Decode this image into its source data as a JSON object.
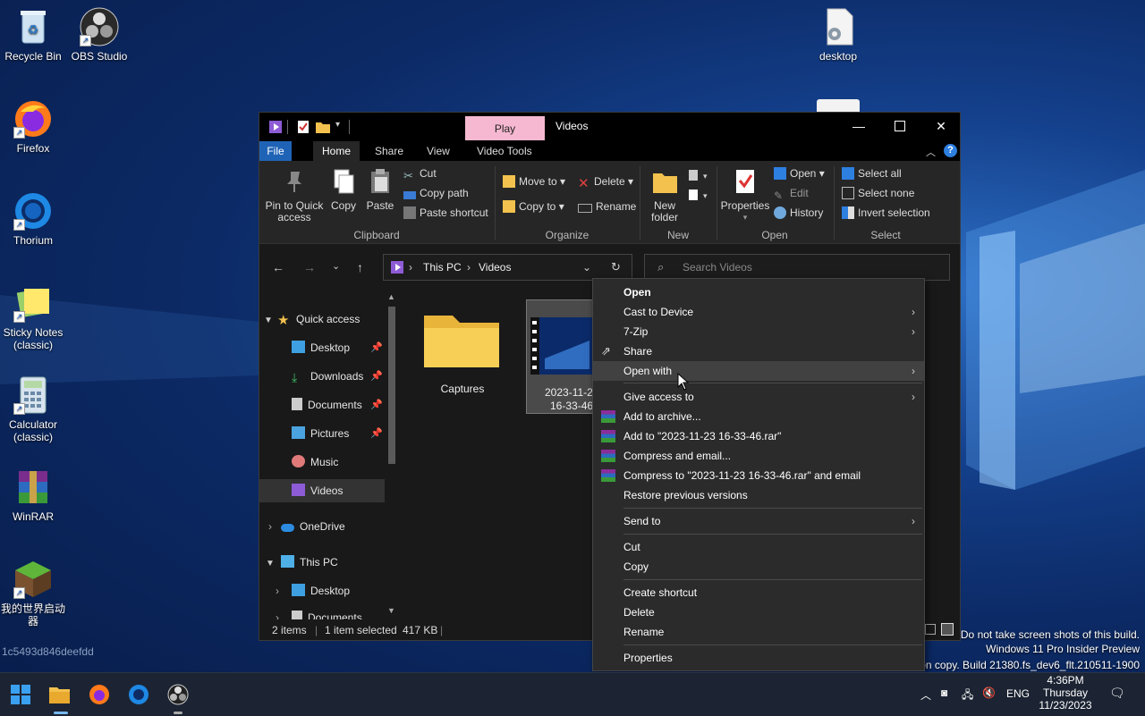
{
  "desktop": {
    "icons": [
      {
        "label": "Recycle Bin"
      },
      {
        "label": "OBS Studio"
      },
      {
        "label": "Firefox"
      },
      {
        "label": "Thorium"
      },
      {
        "label": "Sticky Notes (classic)"
      },
      {
        "label": "Calculator (classic)"
      },
      {
        "label": "WinRAR"
      },
      {
        "label": "我的世界启动器"
      },
      {
        "label": "desktop"
      }
    ],
    "hash": "1c5493d846deefdd"
  },
  "watermark": {
    "line1": "Do not take screen shots of this build.",
    "line2": "Windows 11 Pro Insider Preview",
    "line3": "ation copy. Build 21380.fs_dev6_flt.210511-1900"
  },
  "window": {
    "title": "Videos",
    "context_tab": "Play",
    "tabs": {
      "file": "File",
      "home": "Home",
      "share": "Share",
      "view": "View",
      "video_tools": "Video Tools"
    },
    "ribbon": {
      "pin": "Pin to Quick access",
      "copy": "Copy",
      "paste": "Paste",
      "cut": "Cut",
      "copy_path": "Copy path",
      "paste_shortcut": "Paste shortcut",
      "clipboard": "Clipboard",
      "move_to": "Move to",
      "copy_to": "Copy to",
      "delete": "Delete",
      "rename": "Rename",
      "organize": "Organize",
      "new_folder": "New folder",
      "new": "New",
      "properties": "Properties",
      "open": "Open",
      "edit": "Edit",
      "history": "History",
      "open_group": "Open",
      "select_all": "Select all",
      "select_none": "Select none",
      "invert_selection": "Invert selection",
      "select_group": "Select"
    },
    "address": {
      "crumb1": "This PC",
      "crumb2": "Videos"
    },
    "search_placeholder": "Search Videos",
    "nav": {
      "quick_access": "Quick access",
      "desktop": "Desktop",
      "downloads": "Downloads",
      "documents": "Documents",
      "pictures": "Pictures",
      "music": "Music",
      "videos": "Videos",
      "onedrive": "OneDrive",
      "this_pc": "This PC",
      "pc_desktop": "Desktop",
      "pc_documents": "Documents"
    },
    "files": {
      "folder": "Captures",
      "video_line1": "2023-11-2",
      "video_line2": "16-33-46"
    },
    "status": {
      "items": "2 items",
      "selected": "1 item selected",
      "size": "417 KB"
    }
  },
  "context_menu": {
    "open": "Open",
    "cast": "Cast to Device",
    "zip": "7-Zip",
    "share": "Share",
    "open_with": "Open with",
    "give_access": "Give access to",
    "add_archive": "Add to archive...",
    "add_rar": "Add to \"2023-11-23 16-33-46.rar\"",
    "compress_email": "Compress and email...",
    "compress_rar_email": "Compress to \"2023-11-23 16-33-46.rar\" and email",
    "restore": "Restore previous versions",
    "send_to": "Send to",
    "cut": "Cut",
    "copy": "Copy",
    "create_shortcut": "Create shortcut",
    "delete": "Delete",
    "rename": "Rename",
    "properties": "Properties"
  },
  "taskbar": {
    "lang": "ENG",
    "time": "4:36PM",
    "day": "Thursday",
    "date": "11/23/2023"
  }
}
